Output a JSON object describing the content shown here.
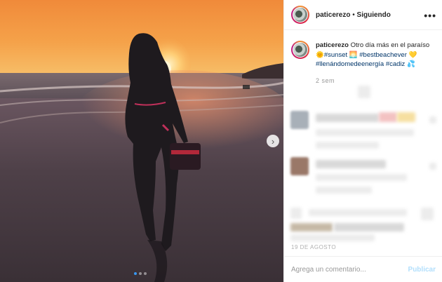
{
  "post": {
    "username": "paticerezo",
    "separator": " • ",
    "follow_status": "Siguiendo",
    "more_label": "•••"
  },
  "caption": {
    "username": "paticerezo",
    "text": "Otro día más en el paraíso",
    "tags": [
      "#sunset",
      "#bestbeachever",
      "#llenándomedeenergía",
      "#cadiz"
    ],
    "time": "2 sem"
  },
  "date_label": "19 DE AGOSTO",
  "footer": {
    "comment_placeholder": "Agrega un comentario...",
    "publish_label": "Publicar"
  },
  "icons": {
    "next": "chevron-right-icon",
    "more": "more-horizontal-icon"
  },
  "carousel": {
    "count": 3,
    "active_index": 0
  },
  "colors": {
    "link": "#003569",
    "publish": "#b2dffc",
    "accent": "#3897f0"
  }
}
